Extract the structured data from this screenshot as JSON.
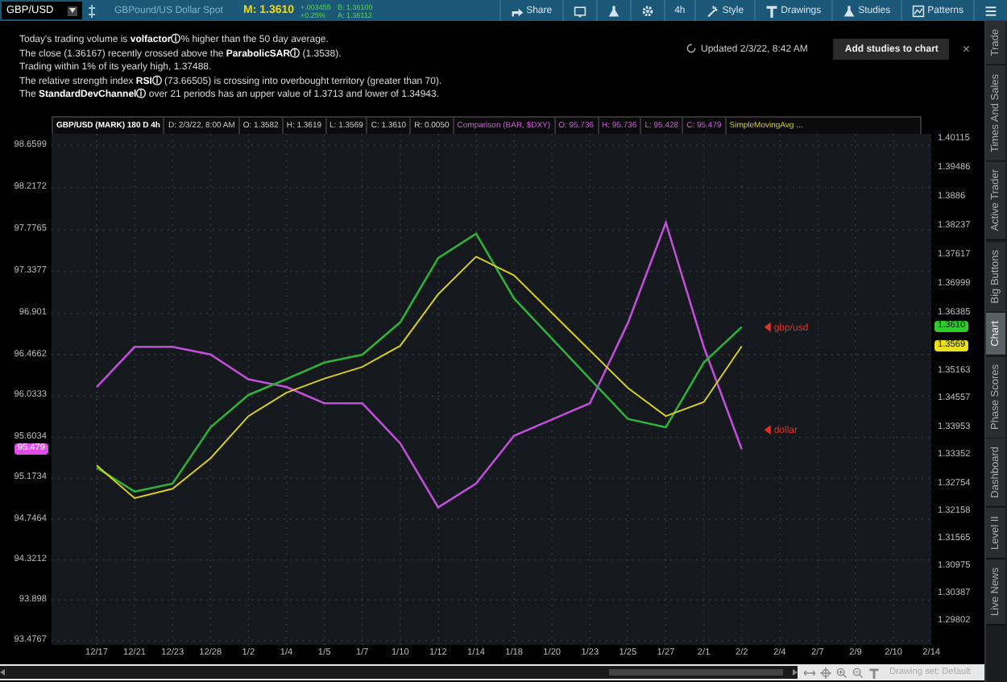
{
  "toolbar": {
    "symbol": "GBP/USD",
    "description": "GBPound/US Dollar Spot",
    "mark": "M: 1.3610",
    "change": "+.003455",
    "change_percent": "+0.25%",
    "bid": "B: 1.36100",
    "ask": "A: 1.36112",
    "buttons": [
      {
        "kind": "share",
        "label": "Share"
      },
      {
        "kind": "screen"
      },
      {
        "kind": "flask"
      },
      {
        "kind": "gear"
      },
      {
        "kind": "text",
        "label": "4h"
      },
      {
        "kind": "style",
        "label": "Style"
      },
      {
        "kind": "drawings",
        "label": "Drawings"
      },
      {
        "kind": "studies",
        "label": "Studies"
      },
      {
        "kind": "patterns",
        "label": "Patterns"
      },
      {
        "kind": "menu"
      }
    ]
  },
  "insights": {
    "lines": [
      "Today's trading volume is **volfactorⓘ**% higher than the 50 day average.",
      "The close (1.36167) recently crossed above the **ParabolicSARⓘ** (1.3538).",
      "Trading within 1% of its yearly high, 1.37488.",
      "The relative strength index **RSIⓘ** (73.66505) is crossing into overbought territory (greater than 70).",
      "The **StandardDevChannelⓘ** over 21 periods has an upper value of 1.3713 and lower of 1.34943."
    ],
    "updated": "Updated 2/3/22, 8:42 AM",
    "button": "Add studies to chart",
    "close": "×"
  },
  "chart_header": [
    {
      "kind": "symbol",
      "text": "GBP/USD (MARK) 180 D 4h"
    },
    {
      "kind": "plain",
      "text": "D: 2/3/22, 8:00 AM"
    },
    {
      "kind": "plain",
      "text": "O: 1.3582"
    },
    {
      "kind": "plain",
      "text": "H: 1.3619"
    },
    {
      "kind": "plain",
      "text": "L: 1.3569"
    },
    {
      "kind": "plain",
      "text": "C: 1.3610"
    },
    {
      "kind": "plain",
      "text": "R: 0.0050"
    },
    {
      "kind": "comparison",
      "text": "Comparison (BAR, $DXY)"
    },
    {
      "kind": "comparison",
      "text": "O: 95.736"
    },
    {
      "kind": "comparison",
      "text": "H: 95.736"
    },
    {
      "kind": "comparison",
      "text": "L: 95.428"
    },
    {
      "kind": "comparison",
      "text": "C: 95.479"
    },
    {
      "kind": "study",
      "text": "SimpleMovingAvg ..."
    }
  ],
  "charts": [
    {
      "chart_data": {
        "type": "line",
        "categories": [
          "12/17",
          "12/21",
          "12/23",
          "12/28",
          "1/2",
          "1/4",
          "1/5",
          "1/7",
          "1/10",
          "1/12",
          "1/14",
          "1/18",
          "1/20",
          "1/23",
          "1/25",
          "1/27",
          "2/1",
          "2/2",
          "2/4",
          "2/7",
          "2/9",
          "2/10",
          "2/14"
        ],
        "ylim": [
          93.43,
          98.78
        ],
        "yticks": [
          {
            "value": 98.6599,
            "label": "98.6599"
          },
          {
            "value": 98.2172,
            "label": "98.2172"
          },
          {
            "value": 97.7765,
            "label": "97.7765"
          },
          {
            "value": 97.3377,
            "label": "97.3377"
          },
          {
            "value": 96.901,
            "label": "96.901"
          },
          {
            "value": 96.4662,
            "label": "96.4662"
          },
          {
            "value": 96.0333,
            "label": "96.0333"
          },
          {
            "value": 95.6034,
            "label": "95.6034"
          },
          {
            "value": 95.1734,
            "label": "95.1734"
          },
          {
            "value": 94.7464,
            "label": "94.7464"
          },
          {
            "value": 94.3212,
            "label": "94.3212"
          },
          {
            "value": 93.898,
            "label": "93.898"
          },
          {
            "value": 93.4767,
            "label": "93.4767"
          }
        ],
        "series": [
          {
            "color": "#c04fd8",
            "values": [
              96.13,
              96.55,
              96.55,
              96.47,
              96.21,
              96.13,
              95.96,
              95.96,
              95.54,
              94.87,
              95.12,
              95.62,
              95.79,
              95.96,
              96.8,
              97.85,
              96.55,
              95.479,
              null,
              null,
              null,
              null,
              null
            ]
          }
        ],
        "annotations": [
          "dollar"
        ]
      },
      "badges": [
        {
          "text": "95.479",
          "color": "#e04ee8"
        }
      ]
    },
    {
      "chart_data": {
        "type": "line",
        "ylim": [
          1.2932,
          1.4022
        ],
        "yticks": [
          {
            "value": 1.40115,
            "label": "1.40115"
          },
          {
            "value": 1.39486,
            "label": "1.39486"
          },
          {
            "value": 1.3886,
            "label": "1.3886"
          },
          {
            "value": 1.38237,
            "label": "1.38237"
          },
          {
            "value": 1.37617,
            "label": "1.37617"
          },
          {
            "value": 1.36999,
            "label": "1.36999"
          },
          {
            "value": 1.36385,
            "label": "1.36385"
          },
          {
            "value": 1.35163,
            "label": "1.35163"
          },
          {
            "value": 1.34557,
            "label": "1.34557"
          },
          {
            "value": 1.33953,
            "label": "1.33953"
          },
          {
            "value": 1.33352,
            "label": "1.33352"
          },
          {
            "value": 1.32754,
            "label": "1.32754"
          },
          {
            "value": 1.32158,
            "label": "1.32158"
          },
          {
            "value": 1.31565,
            "label": "1.31565"
          },
          {
            "value": 1.30975,
            "label": "1.30975"
          },
          {
            "value": 1.30387,
            "label": "1.30387"
          },
          {
            "value": 1.29802,
            "label": "1.29802"
          }
        ],
        "series": [
          {
            "color": "#2fb03c",
            "values": [
              1.331,
              1.3259,
              1.3276,
              1.3396,
              1.3465,
              1.3499,
              1.3534,
              1.3551,
              1.362,
              1.3757,
              1.3809,
              1.3671,
              1.3585,
              1.3499,
              1.3414,
              1.3396,
              1.3534,
              1.361,
              null,
              null,
              null,
              null,
              null
            ]
          },
          {
            "color": "#d6cf1e",
            "values": [
              1.3315,
              1.3245,
              1.3265,
              1.333,
              1.342,
              1.347,
              1.35,
              1.3525,
              1.357,
              1.368,
              1.376,
              1.372,
              1.364,
              1.356,
              1.348,
              1.342,
              1.345,
              1.3569,
              null,
              null,
              null,
              null,
              null
            ]
          }
        ],
        "annotations": [
          "gbp/usd"
        ]
      },
      "badges": [
        {
          "text": "1.3610",
          "color": "#2ecc2e"
        },
        {
          "text": "1.3569",
          "color": "#e8e020"
        }
      ]
    }
  ],
  "status_bar": {
    "drawing_set": "Drawing set: Default"
  },
  "sidebar": {
    "tabs": [
      {
        "label": "Trade",
        "selected": false
      },
      {
        "label": "Times And Sales",
        "selected": false
      },
      {
        "label": "Active Trader",
        "selected": false
      },
      {
        "label": "Big Buttons",
        "selected": false
      },
      {
        "label": "Chart",
        "selected": true
      },
      {
        "label": "Phase Scores",
        "selected": false
      },
      {
        "label": "Dashboard",
        "selected": false
      },
      {
        "label": "Level II",
        "selected": false
      },
      {
        "label": "Live News",
        "selected": false
      }
    ]
  }
}
